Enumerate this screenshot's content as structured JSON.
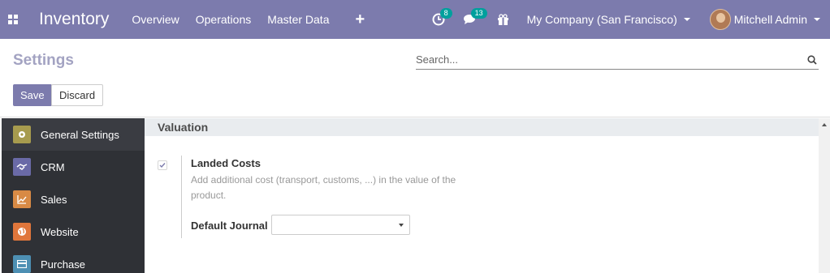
{
  "navbar": {
    "brand": "Inventory",
    "menu": [
      "Overview",
      "Operations",
      "Master Data"
    ],
    "plus_icon": "+",
    "activity_badge": "8",
    "messages_badge": "13",
    "company": "My Company (San Francisco)",
    "user": "Mitchell Admin",
    "accent_color": "#7c7bad"
  },
  "control": {
    "title": "Settings",
    "search_placeholder": "Search...",
    "save_label": "Save",
    "discard_label": "Discard"
  },
  "sidebar": {
    "items": [
      {
        "label": "General Settings",
        "icon": "gear-icon",
        "color": "#a79b4e"
      },
      {
        "label": "CRM",
        "icon": "handshake-icon",
        "color": "#6a6aa7"
      },
      {
        "label": "Sales",
        "icon": "chart-line-icon",
        "color": "#d88a45"
      },
      {
        "label": "Website",
        "icon": "globe-icon",
        "color": "#e0763b"
      },
      {
        "label": "Purchase",
        "icon": "credit-card-icon",
        "color": "#4d8fb3"
      }
    ]
  },
  "main": {
    "section_title": "Valuation",
    "setting": {
      "title": "Landed Costs",
      "description": "Add additional cost (transport, customs, ...) in the value of the product.",
      "checked": true,
      "journal_label": "Default Journal",
      "journal_value": ""
    }
  }
}
